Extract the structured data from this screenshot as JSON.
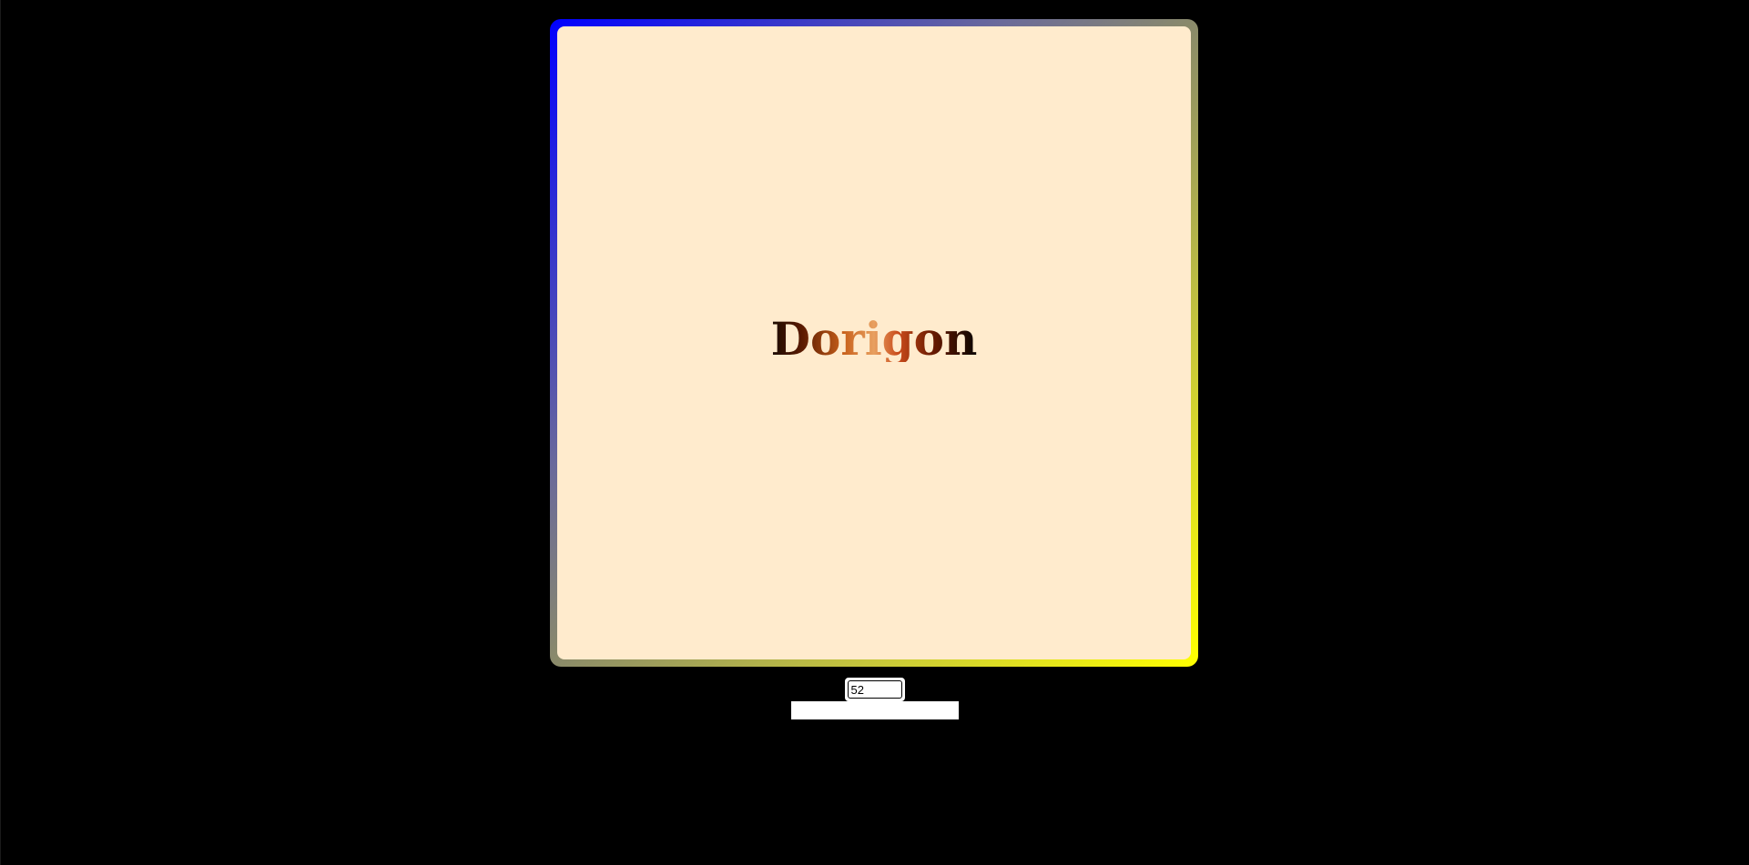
{
  "display": {
    "title": "Dorigon"
  },
  "controls": {
    "size_value": "52",
    "text_value": ""
  },
  "colors": {
    "background": "#000000",
    "panel_fill": "#ffebcd",
    "frame_gradient_start": "#0000ff",
    "frame_gradient_end": "#ffff00"
  }
}
